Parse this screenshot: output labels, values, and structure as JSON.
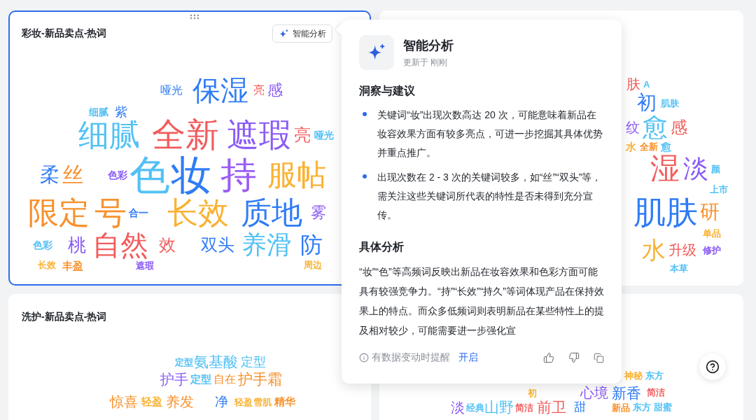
{
  "cards": [
    {
      "title": "彩妆-新品卖点-热词",
      "selected": true,
      "drag_handle": true,
      "action": "智能分析",
      "words": [
        {
          "text": "哑光",
          "color": "#2f7cf6"
        },
        {
          "text": "保湿",
          "color": "#2f7cf6"
        },
        {
          "text": "亮",
          "color": "#f25c5c"
        },
        {
          "text": "感",
          "color": "#8b5cf6"
        },
        {
          "text": "细腻",
          "color": "#52c1f5"
        },
        {
          "text": "紫",
          "color": "#2f7cf6"
        },
        {
          "text": "细腻",
          "color": "#52c1f5"
        },
        {
          "text": "全新",
          "color": "#f25c5c"
        },
        {
          "text": "遮瑕",
          "color": "#8b5cf6"
        },
        {
          "text": "亮",
          "color": "#f25c5c"
        },
        {
          "text": "哑光",
          "color": "#52c1f5"
        },
        {
          "text": "柔",
          "color": "#2f7cf6"
        },
        {
          "text": "丝",
          "color": "#f7912c"
        },
        {
          "text": "色彩",
          "color": "#8b5cf6"
        },
        {
          "text": "色",
          "color": "#52c1f5"
        },
        {
          "text": "妆",
          "color": "#2f7cf6"
        },
        {
          "text": "持",
          "color": "#9b5cf6"
        },
        {
          "text": "服帖",
          "color": "#f9b233"
        },
        {
          "text": "限定",
          "color": "#f7912c"
        },
        {
          "text": "号",
          "color": "#f7912c"
        },
        {
          "text": "合一",
          "color": "#2f7cf6"
        },
        {
          "text": "长效",
          "color": "#f9b233"
        },
        {
          "text": "质地",
          "color": "#2f7cf6"
        },
        {
          "text": "雾",
          "color": "#8b5cf6"
        },
        {
          "text": "色彩",
          "color": "#52c1f5"
        },
        {
          "text": "桃",
          "color": "#8b5cf6"
        },
        {
          "text": "自然",
          "color": "#f25c5c"
        },
        {
          "text": "效",
          "color": "#f25c5c"
        },
        {
          "text": "双头",
          "color": "#2f7cf6"
        },
        {
          "text": "养滑",
          "color": "#52c1f5"
        },
        {
          "text": "防",
          "color": "#2f7cf6"
        },
        {
          "text": "长效",
          "color": "#f9b233"
        },
        {
          "text": "丰盈",
          "color": "#f7912c"
        },
        {
          "text": "遮瑕",
          "color": "#8b5cf6"
        },
        {
          "text": "周边",
          "color": "#f9b233"
        }
      ]
    },
    {
      "selected": false,
      "drag_handle": false,
      "words": [
        {
          "text": "肤",
          "color": "#f25c5c"
        },
        {
          "text": "A",
          "color": "#52c1f5"
        },
        {
          "text": "初",
          "color": "#2f7cf6"
        },
        {
          "text": "肌肤",
          "color": "#52c1f5"
        },
        {
          "text": "纹",
          "color": "#8b5cf6"
        },
        {
          "text": "愈",
          "color": "#52c1f5"
        },
        {
          "text": "感",
          "color": "#f25c5c"
        },
        {
          "text": "水",
          "color": "#f9b233"
        },
        {
          "text": "全新",
          "color": "#f7912c"
        },
        {
          "text": "愈",
          "color": "#52c1f5"
        },
        {
          "text": "湿",
          "color": "#f25c5c"
        },
        {
          "text": "淡",
          "color": "#8b5cf6"
        },
        {
          "text": "颜",
          "color": "#52c1f5"
        },
        {
          "text": "上市",
          "color": "#52c1f5"
        },
        {
          "text": "肌肤",
          "color": "#2f7cf6"
        },
        {
          "text": "研",
          "color": "#f7912c"
        },
        {
          "text": "单品",
          "color": "#f9b233"
        },
        {
          "text": "水",
          "color": "#f9b233"
        },
        {
          "text": "升级",
          "color": "#f25c5c"
        },
        {
          "text": "修护",
          "color": "#8b5cf6"
        },
        {
          "text": "本草",
          "color": "#52c1f5"
        }
      ]
    },
    {
      "title": "洗护-新品卖点-热词",
      "selected": false,
      "drag_handle": false,
      "words": [
        {
          "text": "定型",
          "color": "#52c1f5"
        },
        {
          "text": "氨基酸",
          "color": "#52c1f5"
        },
        {
          "text": "定型",
          "color": "#52c1f5"
        },
        {
          "text": "护手",
          "color": "#8b5cf6"
        },
        {
          "text": "定型",
          "color": "#52c1f5"
        },
        {
          "text": "自在",
          "color": "#f7912c"
        },
        {
          "text": "护手霜",
          "color": "#f7912c"
        },
        {
          "text": "惊喜",
          "color": "#f7912c"
        },
        {
          "text": "轻盈",
          "color": "#f9b233"
        },
        {
          "text": "养发",
          "color": "#f7912c"
        },
        {
          "text": "净",
          "color": "#2f7cf6"
        },
        {
          "text": "轻盈",
          "color": "#f9b233"
        },
        {
          "text": "雪肌",
          "color": "#f9b233"
        },
        {
          "text": "精华",
          "color": "#f7912c"
        }
      ]
    },
    {
      "selected": false,
      "drag_handle": false,
      "words": [
        {
          "text": "神秘",
          "color": "#f9b233"
        },
        {
          "text": "东方",
          "color": "#52c1f5"
        },
        {
          "text": "初",
          "color": "#f9b233"
        },
        {
          "text": "心境",
          "color": "#8b5cf6"
        },
        {
          "text": "新香",
          "color": "#2f7cf6"
        },
        {
          "text": "简洁",
          "color": "#f25c5c"
        },
        {
          "text": "淡",
          "color": "#8b5cf6"
        },
        {
          "text": "经典",
          "color": "#52c1f5"
        },
        {
          "text": "山野",
          "color": "#52c1f5"
        },
        {
          "text": "简洁",
          "color": "#f25c5c"
        },
        {
          "text": "前卫",
          "color": "#f25c5c"
        },
        {
          "text": "甜",
          "color": "#2f7cf6"
        },
        {
          "text": "新品",
          "color": "#f7912c"
        },
        {
          "text": "东方",
          "color": "#52c1f5"
        },
        {
          "text": "甜蜜",
          "color": "#52c1f5"
        }
      ]
    }
  ],
  "popup": {
    "title": "智能分析",
    "updated": "更新于 刚刚",
    "sections": [
      {
        "kind": "bullets",
        "heading": "洞察与建议",
        "items": [
          "关键词“妆”出现次数高达 20 次，可能意味着新品在妆容效果方面有较多亮点，可进一步挖掘其具体优势并重点推广。",
          "出现次数在 2 - 3 次的关键词较多，如“丝”“双头”等，需关注这些关键词所代表的特性是否未得到充分宣传。"
        ]
      },
      {
        "kind": "paragraph",
        "heading": "具体分析",
        "text": "“妆”“色”等高频词反映出新品在妆容效果和色彩方面可能具有较强竞争力。“持”“长效”“持久”等词体现产品在保持效果上的特点。而众多低频词则表明新品在某些特性上的提及相对较少，可能需要进一步强化宣"
      }
    ],
    "footer": {
      "notice": "有数据变动时提醒",
      "action": "开启"
    }
  },
  "help_button": true
}
